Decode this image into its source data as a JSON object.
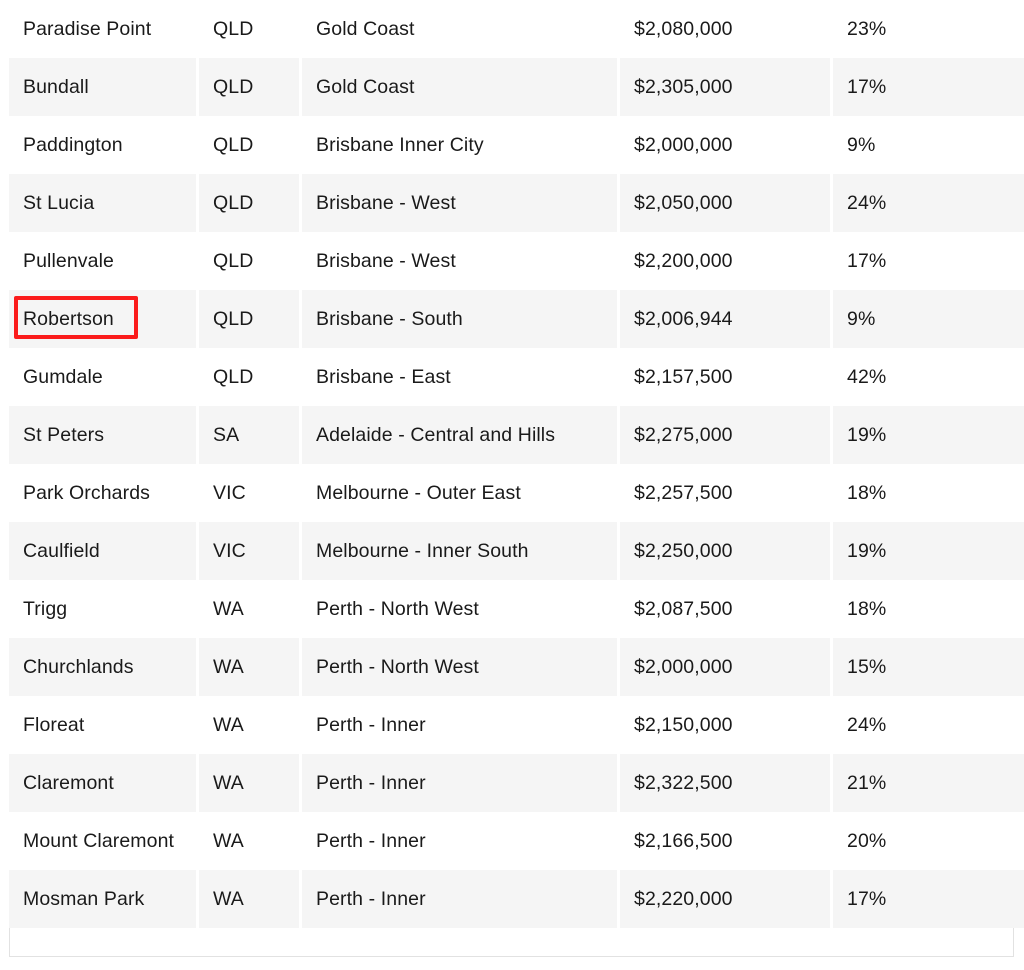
{
  "table": {
    "columns": [
      {
        "key": "suburb",
        "name": "suburb-column"
      },
      {
        "key": "state",
        "name": "state-column"
      },
      {
        "key": "region",
        "name": "region-column"
      },
      {
        "key": "price",
        "name": "median-price-column"
      },
      {
        "key": "growth",
        "name": "growth-column"
      }
    ],
    "rows": [
      {
        "suburb": "Paradise Point",
        "state": "QLD",
        "region": "Gold Coast",
        "price": "$2,080,000",
        "growth": "23%"
      },
      {
        "suburb": "Bundall",
        "state": "QLD",
        "region": "Gold Coast",
        "price": "$2,305,000",
        "growth": "17%"
      },
      {
        "suburb": "Paddington",
        "state": "QLD",
        "region": "Brisbane Inner City",
        "price": "$2,000,000",
        "growth": "9%"
      },
      {
        "suburb": "St Lucia",
        "state": "QLD",
        "region": "Brisbane - West",
        "price": "$2,050,000",
        "growth": "24%"
      },
      {
        "suburb": "Pullenvale",
        "state": "QLD",
        "region": "Brisbane - West",
        "price": "$2,200,000",
        "growth": "17%"
      },
      {
        "suburb": "Robertson",
        "state": "QLD",
        "region": "Brisbane - South",
        "price": "$2,006,944",
        "growth": "9%"
      },
      {
        "suburb": "Gumdale",
        "state": "QLD",
        "region": "Brisbane - East",
        "price": "$2,157,500",
        "growth": "42%"
      },
      {
        "suburb": "St Peters",
        "state": "SA",
        "region": "Adelaide - Central and Hills",
        "price": "$2,275,000",
        "growth": "19%"
      },
      {
        "suburb": "Park Orchards",
        "state": "VIC",
        "region": "Melbourne - Outer East",
        "price": "$2,257,500",
        "growth": "18%"
      },
      {
        "suburb": "Caulfield",
        "state": "VIC",
        "region": "Melbourne - Inner South",
        "price": "$2,250,000",
        "growth": "19%"
      },
      {
        "suburb": "Trigg",
        "state": "WA",
        "region": "Perth - North West",
        "price": "$2,087,500",
        "growth": "18%"
      },
      {
        "suburb": "Churchlands",
        "state": "WA",
        "region": "Perth - North West",
        "price": "$2,000,000",
        "growth": "15%"
      },
      {
        "suburb": "Floreat",
        "state": "WA",
        "region": "Perth - Inner",
        "price": "$2,150,000",
        "growth": "24%"
      },
      {
        "suburb": "Claremont",
        "state": "WA",
        "region": "Perth - Inner",
        "price": "$2,322,500",
        "growth": "21%"
      },
      {
        "suburb": "Mount Claremont",
        "state": "WA",
        "region": "Perth - Inner",
        "price": "$2,166,500",
        "growth": "20%"
      },
      {
        "suburb": "Mosman Park",
        "state": "WA",
        "region": "Perth - Inner",
        "price": "$2,220,000",
        "growth": "17%"
      }
    ]
  },
  "annotation": {
    "highlighted_cell_text": "Robertson",
    "highlight_color": "#fb1b1b",
    "highlight_row_index": 5
  },
  "colors": {
    "row_odd_background": "#ffffff",
    "row_even_background": "#f5f5f5",
    "text": "#1a1a1a",
    "border": "#e2e2e2"
  }
}
